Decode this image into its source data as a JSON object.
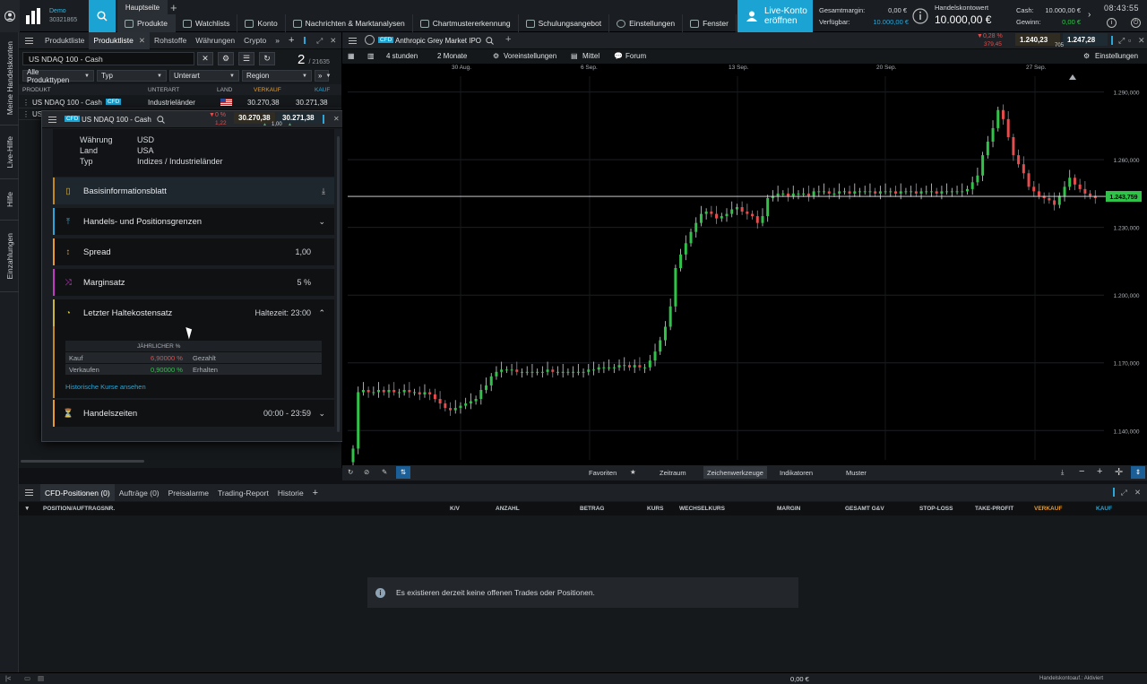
{
  "topbar": {
    "demo_label": "Demo",
    "account_number": "30321865",
    "main_tab": "Hauptseite",
    "nav": [
      "Produkte",
      "Watchlists",
      "Konto",
      "Nachrichten & Marktanalysen",
      "Chartmustererkennung",
      "Schulungsangebot",
      "Einstellungen",
      "Fenster"
    ],
    "live_button": "Live-Konto eröffnen",
    "gesamtmargin_label": "Gesamtmargin:",
    "gesamtmargin_value": "0,00 €",
    "verfuegbar_label": "Verfügbar:",
    "verfuegbar_value": "10.000,00 €",
    "handelskontowert_label": "Handelskontowert",
    "handelskontowert_value": "10.000,00 €",
    "cash_label": "Cash:",
    "cash_value": "10.000,00 €",
    "gewinn_label": "Gewinn:",
    "gewinn_value": "0,00 €",
    "clock": "08:43:55"
  },
  "sidetabs": [
    "Meine Handelskonten",
    "Live-Hilfe",
    "Hilfe",
    "Einzahlungen"
  ],
  "productlist": {
    "tabs": [
      "Produktliste",
      "Produktliste",
      "Rohstoffe",
      "Währungen",
      "Crypto"
    ],
    "search_value": "US NDAQ 100 - Cash",
    "count": "2",
    "total": "/ 21635",
    "filters": [
      "Alle Produkttypen",
      "Typ",
      "Unterart",
      "Region"
    ],
    "columns": {
      "produkt": "PRODUKT",
      "unterart": "UNTERART",
      "land": "LAND",
      "verkauf": "VERKAUF",
      "kauf": "KAUF"
    },
    "rows": [
      {
        "name": "US NDAQ 100 - Cash",
        "badge": "CFD",
        "unterart": "Industrieländer",
        "verkauf": "30.270,38",
        "kauf": "30.271,38"
      },
      {
        "name": "US",
        "badge": "",
        "unterart": "",
        "verkauf": "",
        "kauf": ""
      }
    ]
  },
  "popup": {
    "badge": "CFD",
    "title": "US NDAQ 100 - Cash",
    "change": "0 %",
    "change_abs": "1,22",
    "sell": "30.270,38",
    "buy": "30.271,38",
    "spread": "1,00",
    "info": [
      {
        "label": "Währung",
        "value": "USD"
      },
      {
        "label": "Land",
        "value": "USA"
      },
      {
        "label": "Typ",
        "value": "Indizes / Industrieländer"
      }
    ],
    "cards": [
      {
        "label": "Basisinformationsblatt",
        "value": ""
      },
      {
        "label": "Handels- und Positionsgrenzen",
        "value": ""
      },
      {
        "label": "Spread",
        "value": "1,00"
      },
      {
        "label": "Marginsatz",
        "value": "5 %"
      },
      {
        "label": "Letzter Haltekostensatz",
        "value": "Haltezeit: 23:00"
      }
    ],
    "halte": {
      "col_header": "JÄHRLICHER %",
      "rows": [
        {
          "label": "Kauf",
          "value": "6,90000 %",
          "note": "Gezahlt"
        },
        {
          "label": "Verkaufen",
          "value": "0,90000 %",
          "note": "Erhalten"
        }
      ],
      "link": "Historische Kurse ansehen"
    },
    "handelszeiten_label": "Handelszeiten",
    "handelszeiten_value": "00:00 - 23:59"
  },
  "chart": {
    "tab_badge": "CFD",
    "tab_title": "Anthropic Grey Market IPO",
    "change_pct": "0,28 %",
    "change_abs": "379,45",
    "sell": "1.240,23",
    "buy": "1.247,28",
    "spread": "705",
    "toolbar": [
      "4 stunden",
      "2 Monate",
      "Voreinstellungen",
      "Mittel",
      "Forum",
      "Einstellungen"
    ],
    "bottom": [
      "Favoriten",
      "Zeitraum",
      "Zeichenwerkzeuge",
      "Indikatoren",
      "Muster"
    ],
    "current_price": "1.243,759"
  },
  "chart_data": {
    "type": "candlestick",
    "x_labels": [
      "30 Aug.",
      "6 Sep.",
      "13 Sep.",
      "20 Sep.",
      "27 Sep."
    ],
    "y_ticks": [
      "1.140,000",
      "1.170,000",
      "1.200,000",
      "1.230,000",
      "1.260,000",
      "1.290,000"
    ],
    "ylim": [
      1127,
      1297
    ],
    "current_price": 1243.759,
    "closes": [
      1132,
      1157,
      1158,
      1157,
      1157,
      1158,
      1157,
      1158,
      1157,
      1157,
      1158,
      1157,
      1157,
      1156,
      1157,
      1156,
      1154,
      1152,
      1150,
      1149,
      1150,
      1151,
      1152,
      1153,
      1154,
      1158,
      1160,
      1164,
      1166,
      1167,
      1167,
      1167,
      1166,
      1166,
      1166,
      1166,
      1166,
      1166,
      1167,
      1166,
      1166,
      1166,
      1166,
      1166,
      1166,
      1166,
      1167,
      1167,
      1168,
      1168,
      1168,
      1168,
      1169,
      1169,
      1168,
      1169,
      1168,
      1168,
      1171,
      1175,
      1180,
      1186,
      1195,
      1212,
      1218,
      1223,
      1228,
      1232,
      1236,
      1237,
      1236,
      1234,
      1235,
      1236,
      1238,
      1239,
      1237,
      1236,
      1235,
      1232,
      1235,
      1243,
      1244,
      1245,
      1245,
      1244,
      1245,
      1245,
      1245,
      1244,
      1246,
      1246,
      1246,
      1245,
      1245,
      1246,
      1246,
      1245,
      1246,
      1246,
      1246,
      1246,
      1245,
      1246,
      1246,
      1246,
      1245,
      1246,
      1246,
      1246,
      1245,
      1246,
      1246,
      1246,
      1245,
      1246,
      1246,
      1246,
      1246,
      1246,
      1247,
      1250,
      1253,
      1262,
      1268,
      1274,
      1282,
      1278,
      1270,
      1262,
      1258,
      1254,
      1248,
      1246,
      1244,
      1243,
      1242,
      1240,
      1244,
      1248,
      1252,
      1249,
      1247,
      1245,
      1244,
      1243
    ]
  },
  "positions": {
    "tabs": [
      "CFD-Positionen (0)",
      "Aufträge (0)",
      "Preisalarme",
      "Trading-Report",
      "Historie"
    ],
    "columns": [
      "POSITION/AUFTRAGSNR.",
      "K/V",
      "ANZAHL",
      "BETRAG",
      "KURS",
      "WECHSELKURS",
      "MARGIN",
      "GESAMT G&V",
      "STOP-LOSS",
      "TAKE-PROFIT",
      "VERKAUF",
      "KAUF"
    ],
    "empty_message": "Es existieren derzeit keine offenen Trades oder Positionen."
  },
  "statusbar": {
    "total": "0,00 €",
    "status": "Handelskontoauf.: Aktiviert"
  },
  "colors": {
    "accent": "#1ba4d3",
    "up": "#31c24a",
    "down": "#e74c4c",
    "orange": "#e89a2a"
  }
}
